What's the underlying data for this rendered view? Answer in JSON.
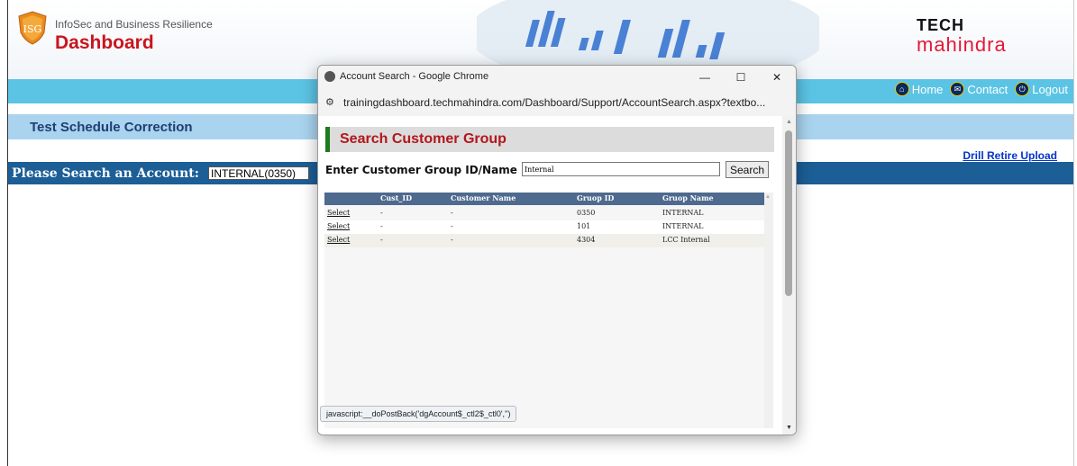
{
  "header": {
    "logo_badge": "ISG",
    "logo_subtitle": "InfoSec and Business Resilience",
    "logo_title": "Dashboard",
    "brand_top": "TECH",
    "brand_bottom": "mahindra"
  },
  "nav": {
    "items": [
      {
        "label": "Home",
        "icon": "home-icon"
      },
      {
        "label": "Contact",
        "icon": "mail-icon"
      },
      {
        "label": "Logout",
        "icon": "logout-icon"
      }
    ]
  },
  "page": {
    "section_title": "Test Schedule Correction",
    "drill_link": "Drill Retire Upload",
    "search_label": "Please Search an Account:",
    "search_value": "INTERNAL(0350)"
  },
  "popup": {
    "window_title": "Account Search - Google Chrome",
    "url": "trainingdashboard.techmahindra.com/Dashboard/Support/AccountSearch.aspx?textbo...",
    "heading": "Search Customer Group",
    "label": "Enter Customer Group ID/Name :",
    "input_value": "Internal",
    "search_button": "Search",
    "status_text": "javascript:__doPostBack('dgAccount$_ctl2$_ctl0','')",
    "columns": [
      "Cust_ID",
      "Customer Name",
      "Gruop ID",
      "Gruop Name"
    ],
    "rows": [
      {
        "action": "Select",
        "cust_id": "-",
        "customer_name": "-",
        "group_id": "0350",
        "group_name": "INTERNAL"
      },
      {
        "action": "Select",
        "cust_id": "-",
        "customer_name": "-",
        "group_id": "101",
        "group_name": "INTERNAL"
      },
      {
        "action": "Select",
        "cust_id": "-",
        "customer_name": "-",
        "group_id": "4304",
        "group_name": "LCC Internal"
      }
    ]
  },
  "colors": {
    "nav_bar": "#5bc4e4",
    "section_bar": "#a9d3ee",
    "search_bar": "#1c5e96",
    "brand_red": "#c9151e",
    "grid_header": "#4e6a8e"
  }
}
